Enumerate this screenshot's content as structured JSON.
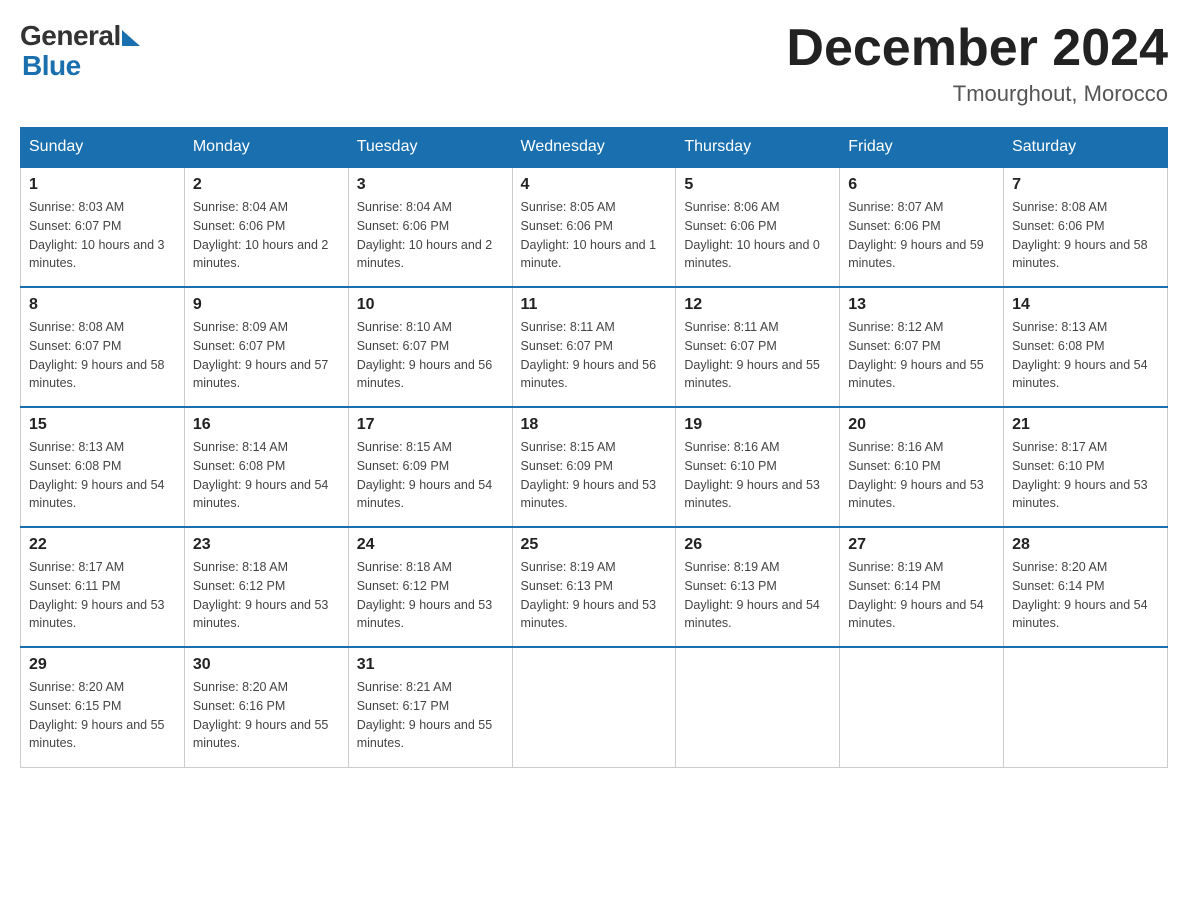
{
  "header": {
    "month_title": "December 2024",
    "location": "Tmourghout, Morocco"
  },
  "logo": {
    "general": "General",
    "blue": "Blue"
  },
  "days_of_week": [
    "Sunday",
    "Monday",
    "Tuesday",
    "Wednesday",
    "Thursday",
    "Friday",
    "Saturday"
  ],
  "weeks": [
    [
      {
        "day": "1",
        "sunrise": "8:03 AM",
        "sunset": "6:07 PM",
        "daylight": "10 hours and 3 minutes."
      },
      {
        "day": "2",
        "sunrise": "8:04 AM",
        "sunset": "6:06 PM",
        "daylight": "10 hours and 2 minutes."
      },
      {
        "day": "3",
        "sunrise": "8:04 AM",
        "sunset": "6:06 PM",
        "daylight": "10 hours and 2 minutes."
      },
      {
        "day": "4",
        "sunrise": "8:05 AM",
        "sunset": "6:06 PM",
        "daylight": "10 hours and 1 minute."
      },
      {
        "day": "5",
        "sunrise": "8:06 AM",
        "sunset": "6:06 PM",
        "daylight": "10 hours and 0 minutes."
      },
      {
        "day": "6",
        "sunrise": "8:07 AM",
        "sunset": "6:06 PM",
        "daylight": "9 hours and 59 minutes."
      },
      {
        "day": "7",
        "sunrise": "8:08 AM",
        "sunset": "6:06 PM",
        "daylight": "9 hours and 58 minutes."
      }
    ],
    [
      {
        "day": "8",
        "sunrise": "8:08 AM",
        "sunset": "6:07 PM",
        "daylight": "9 hours and 58 minutes."
      },
      {
        "day": "9",
        "sunrise": "8:09 AM",
        "sunset": "6:07 PM",
        "daylight": "9 hours and 57 minutes."
      },
      {
        "day": "10",
        "sunrise": "8:10 AM",
        "sunset": "6:07 PM",
        "daylight": "9 hours and 56 minutes."
      },
      {
        "day": "11",
        "sunrise": "8:11 AM",
        "sunset": "6:07 PM",
        "daylight": "9 hours and 56 minutes."
      },
      {
        "day": "12",
        "sunrise": "8:11 AM",
        "sunset": "6:07 PM",
        "daylight": "9 hours and 55 minutes."
      },
      {
        "day": "13",
        "sunrise": "8:12 AM",
        "sunset": "6:07 PM",
        "daylight": "9 hours and 55 minutes."
      },
      {
        "day": "14",
        "sunrise": "8:13 AM",
        "sunset": "6:08 PM",
        "daylight": "9 hours and 54 minutes."
      }
    ],
    [
      {
        "day": "15",
        "sunrise": "8:13 AM",
        "sunset": "6:08 PM",
        "daylight": "9 hours and 54 minutes."
      },
      {
        "day": "16",
        "sunrise": "8:14 AM",
        "sunset": "6:08 PM",
        "daylight": "9 hours and 54 minutes."
      },
      {
        "day": "17",
        "sunrise": "8:15 AM",
        "sunset": "6:09 PM",
        "daylight": "9 hours and 54 minutes."
      },
      {
        "day": "18",
        "sunrise": "8:15 AM",
        "sunset": "6:09 PM",
        "daylight": "9 hours and 53 minutes."
      },
      {
        "day": "19",
        "sunrise": "8:16 AM",
        "sunset": "6:10 PM",
        "daylight": "9 hours and 53 minutes."
      },
      {
        "day": "20",
        "sunrise": "8:16 AM",
        "sunset": "6:10 PM",
        "daylight": "9 hours and 53 minutes."
      },
      {
        "day": "21",
        "sunrise": "8:17 AM",
        "sunset": "6:10 PM",
        "daylight": "9 hours and 53 minutes."
      }
    ],
    [
      {
        "day": "22",
        "sunrise": "8:17 AM",
        "sunset": "6:11 PM",
        "daylight": "9 hours and 53 minutes."
      },
      {
        "day": "23",
        "sunrise": "8:18 AM",
        "sunset": "6:12 PM",
        "daylight": "9 hours and 53 minutes."
      },
      {
        "day": "24",
        "sunrise": "8:18 AM",
        "sunset": "6:12 PM",
        "daylight": "9 hours and 53 minutes."
      },
      {
        "day": "25",
        "sunrise": "8:19 AM",
        "sunset": "6:13 PM",
        "daylight": "9 hours and 53 minutes."
      },
      {
        "day": "26",
        "sunrise": "8:19 AM",
        "sunset": "6:13 PM",
        "daylight": "9 hours and 54 minutes."
      },
      {
        "day": "27",
        "sunrise": "8:19 AM",
        "sunset": "6:14 PM",
        "daylight": "9 hours and 54 minutes."
      },
      {
        "day": "28",
        "sunrise": "8:20 AM",
        "sunset": "6:14 PM",
        "daylight": "9 hours and 54 minutes."
      }
    ],
    [
      {
        "day": "29",
        "sunrise": "8:20 AM",
        "sunset": "6:15 PM",
        "daylight": "9 hours and 55 minutes."
      },
      {
        "day": "30",
        "sunrise": "8:20 AM",
        "sunset": "6:16 PM",
        "daylight": "9 hours and 55 minutes."
      },
      {
        "day": "31",
        "sunrise": "8:21 AM",
        "sunset": "6:17 PM",
        "daylight": "9 hours and 55 minutes."
      },
      null,
      null,
      null,
      null
    ]
  ],
  "labels": {
    "sunrise": "Sunrise:",
    "sunset": "Sunset:",
    "daylight": "Daylight:"
  }
}
